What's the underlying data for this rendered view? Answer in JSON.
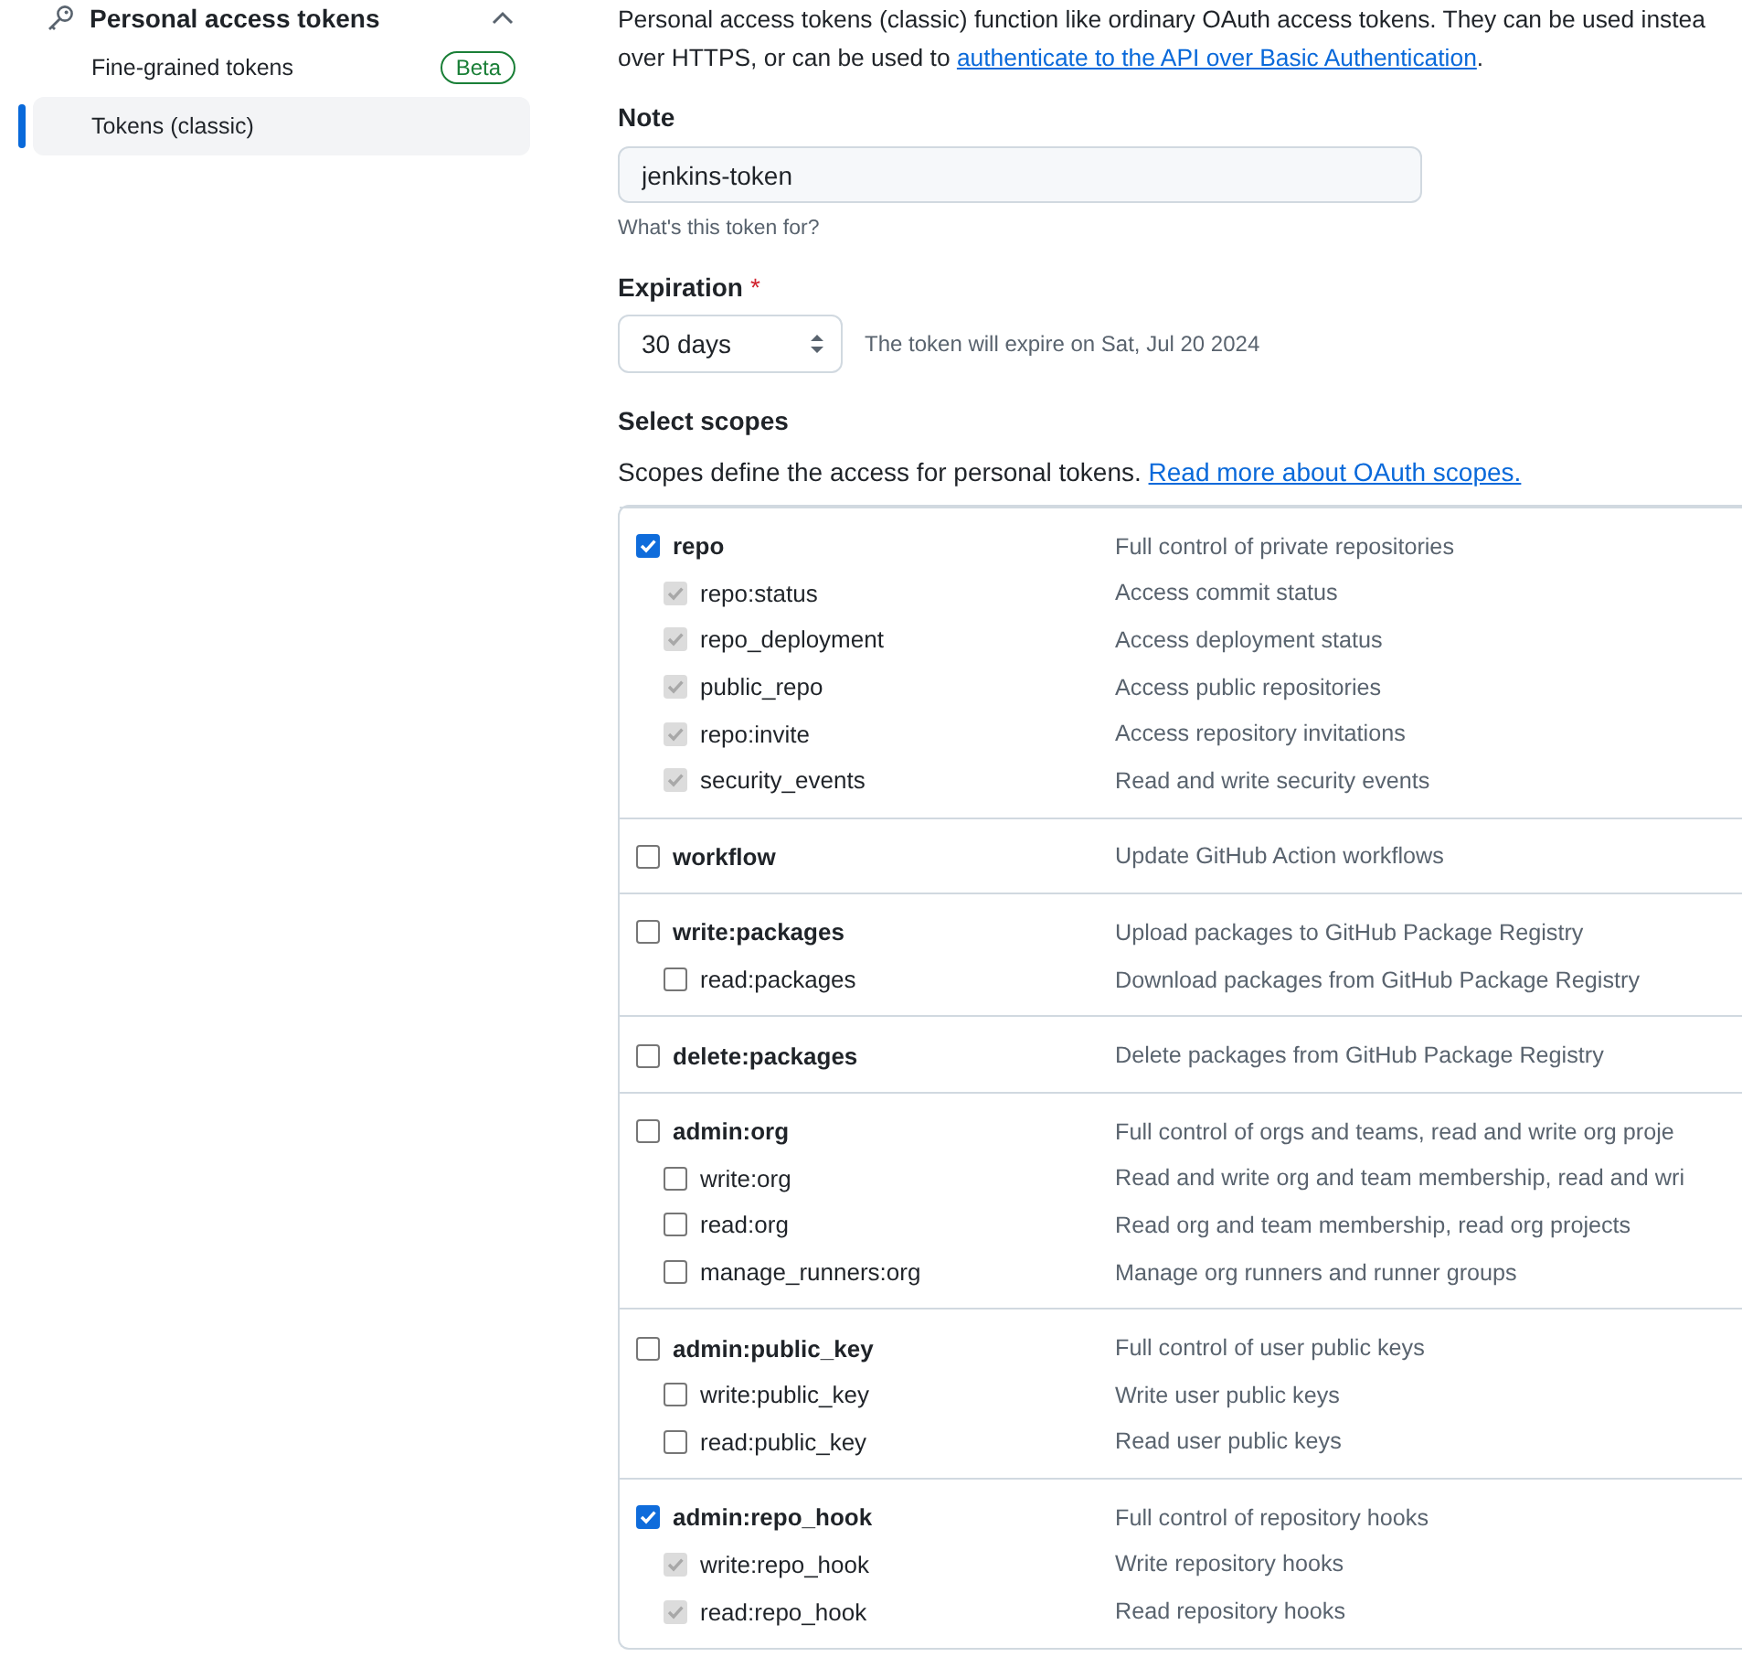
{
  "sidebar": {
    "section": {
      "label": "Personal access tokens",
      "expanded": true
    },
    "items": [
      {
        "label": "Fine-grained tokens",
        "badge": "Beta",
        "selected": false
      },
      {
        "label": "Tokens (classic)",
        "selected": true
      }
    ]
  },
  "intro": {
    "line_1": "Personal access tokens (classic) function like ordinary OAuth access tokens. They can be used instea",
    "line_2": "over HTTPS, or can be used to ",
    "link": "authenticate to the API over Basic Authentication",
    "line_2_end": "."
  },
  "note": {
    "label": "Note",
    "value": "jenkins-token",
    "hint": "What's this token for?"
  },
  "expiration": {
    "label": "Expiration",
    "required": "*",
    "value": "30 days",
    "info": "The token will expire on Sat, Jul 20 2024"
  },
  "scopes": {
    "title": "Select scopes",
    "description": "Scopes define the access for personal tokens. ",
    "link": "Read more about OAuth scopes.",
    "groups": [
      {
        "name": "repo",
        "description": "Full control of private repositories",
        "checked": true,
        "children": [
          {
            "name": "repo:status",
            "description": "Access commit status",
            "checked": true,
            "disabled": true
          },
          {
            "name": "repo_deployment",
            "description": "Access deployment status",
            "checked": true,
            "disabled": true
          },
          {
            "name": "public_repo",
            "description": "Access public repositories",
            "checked": true,
            "disabled": true
          },
          {
            "name": "repo:invite",
            "description": "Access repository invitations",
            "checked": true,
            "disabled": true
          },
          {
            "name": "security_events",
            "description": "Read and write security events",
            "checked": true,
            "disabled": true
          }
        ]
      },
      {
        "name": "workflow",
        "description": "Update GitHub Action workflows",
        "checked": false
      },
      {
        "name": "write:packages",
        "description": "Upload packages to GitHub Package Registry",
        "checked": false,
        "children": [
          {
            "name": "read:packages",
            "description": "Download packages from GitHub Package Registry",
            "checked": false,
            "disabled": false
          }
        ]
      },
      {
        "name": "delete:packages",
        "description": "Delete packages from GitHub Package Registry",
        "checked": false
      },
      {
        "name": "admin:org",
        "description": "Full control of orgs and teams, read and write org proje",
        "checked": false,
        "children": [
          {
            "name": "write:org",
            "description": "Read and write org and team membership, read and wri",
            "checked": false,
            "disabled": false
          },
          {
            "name": "read:org",
            "description": "Read org and team membership, read org projects",
            "checked": false,
            "disabled": false
          },
          {
            "name": "manage_runners:org",
            "description": "Manage org runners and runner groups",
            "checked": false,
            "disabled": false
          }
        ]
      },
      {
        "name": "admin:public_key",
        "description": "Full control of user public keys",
        "checked": false,
        "children": [
          {
            "name": "write:public_key",
            "description": "Write user public keys",
            "checked": false,
            "disabled": false
          },
          {
            "name": "read:public_key",
            "description": "Read user public keys",
            "checked": false,
            "disabled": false
          }
        ]
      },
      {
        "name": "admin:repo_hook",
        "description": "Full control of repository hooks",
        "checked": true,
        "children": [
          {
            "name": "write:repo_hook",
            "description": "Write repository hooks",
            "checked": true,
            "disabled": true
          },
          {
            "name": "read:repo_hook",
            "description": "Read repository hooks",
            "checked": true,
            "disabled": true
          }
        ]
      }
    ]
  }
}
